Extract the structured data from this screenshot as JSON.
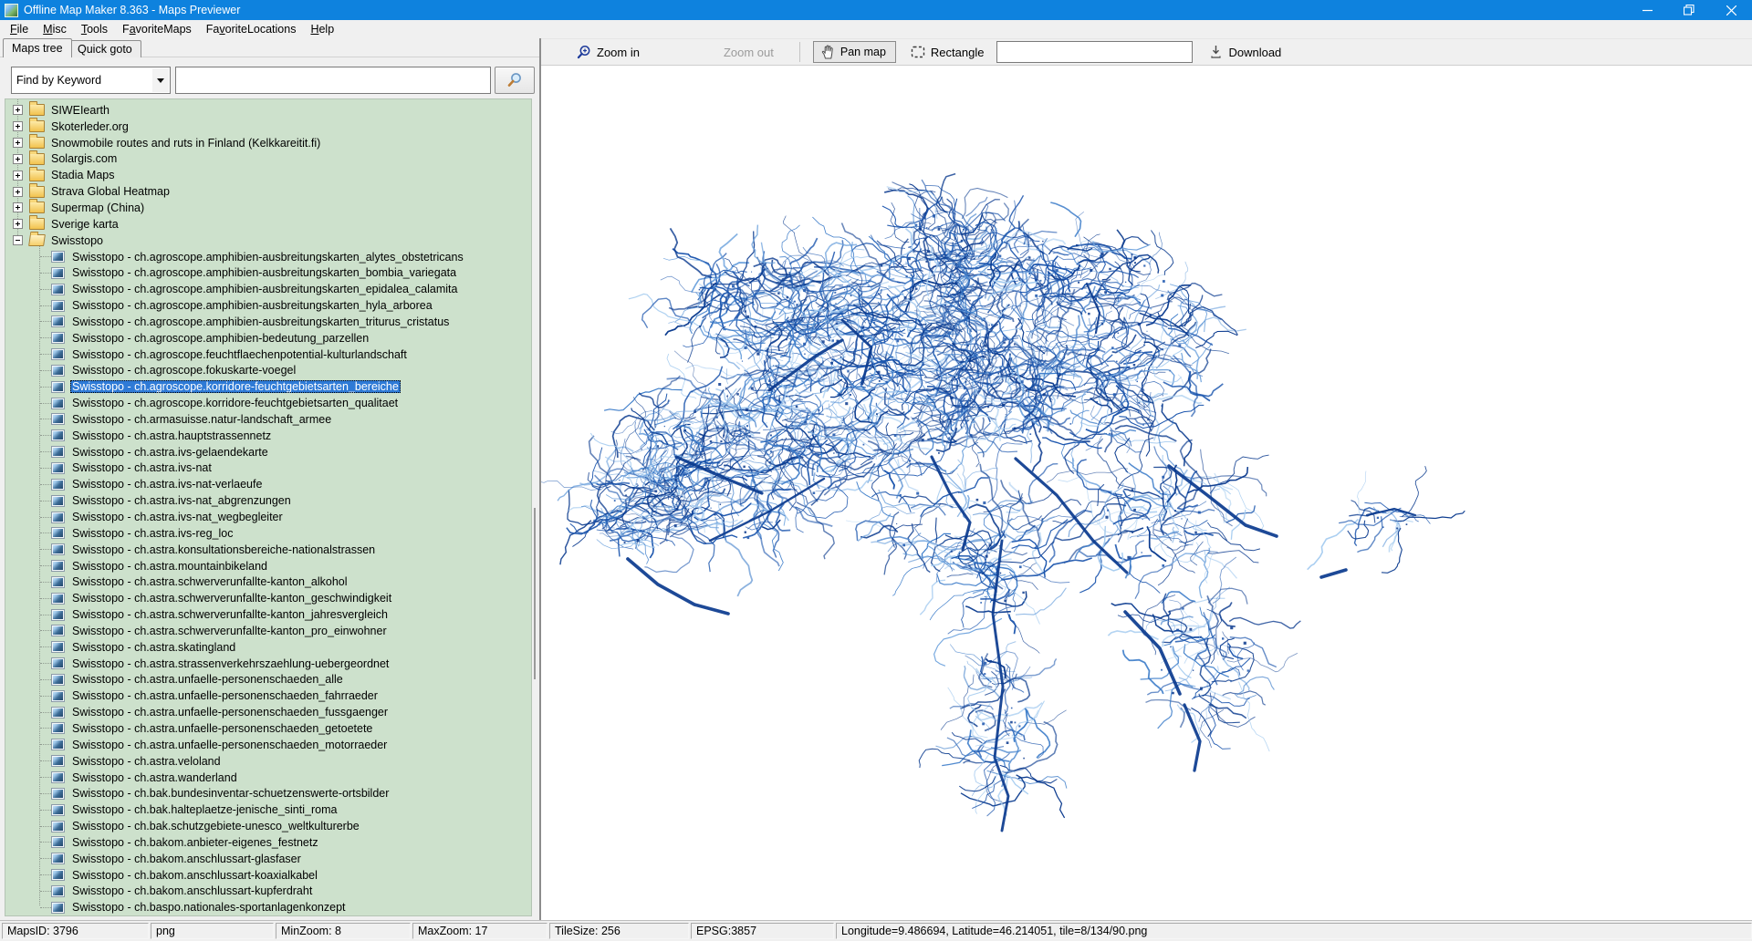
{
  "window": {
    "title": "Offline Map Maker 8.363 - Maps Previewer"
  },
  "titlebar_buttons": {
    "minimize": "minimize",
    "restore": "restore",
    "close": "close"
  },
  "menu": {
    "items": [
      {
        "pre": "",
        "key": "F",
        "post": "ile"
      },
      {
        "pre": "",
        "key": "M",
        "post": "isc"
      },
      {
        "pre": "",
        "key": "T",
        "post": "ools"
      },
      {
        "pre": "F",
        "key": "a",
        "post": "voriteMaps"
      },
      {
        "pre": "Fa",
        "key": "v",
        "post": "oriteLocations"
      },
      {
        "pre": "",
        "key": "H",
        "post": "elp"
      }
    ]
  },
  "left_panel": {
    "tabs": [
      {
        "label": "Maps tree",
        "active": true
      },
      {
        "label": "Quick goto",
        "active": false
      }
    ],
    "search": {
      "mode_value": "Find by Keyword",
      "input_value": "",
      "input_placeholder": ""
    }
  },
  "tree": {
    "rows": [
      {
        "t": "folder",
        "label": "SIWEIearth"
      },
      {
        "t": "folder",
        "label": "Skoterleder.org"
      },
      {
        "t": "folder",
        "label": "Snowmobile routes and ruts in Finland (Kelkkareitit.fi)"
      },
      {
        "t": "folder",
        "label": "Solargis.com"
      },
      {
        "t": "folder",
        "label": "Stadia Maps"
      },
      {
        "t": "folder",
        "label": "Strava Global Heatmap"
      },
      {
        "t": "folder",
        "label": "Supermap (China)"
      },
      {
        "t": "folder",
        "label": "Sverige karta"
      },
      {
        "t": "folder",
        "label": "Swisstopo",
        "expanded": true
      },
      {
        "t": "leaf",
        "label": "Swisstopo - ch.agroscope.amphibien-ausbreitungskarten_alytes_obstetricans"
      },
      {
        "t": "leaf",
        "label": "Swisstopo - ch.agroscope.amphibien-ausbreitungskarten_bombia_variegata"
      },
      {
        "t": "leaf",
        "label": "Swisstopo - ch.agroscope.amphibien-ausbreitungskarten_epidalea_calamita"
      },
      {
        "t": "leaf",
        "label": "Swisstopo - ch.agroscope.amphibien-ausbreitungskarten_hyla_arborea"
      },
      {
        "t": "leaf",
        "label": "Swisstopo - ch.agroscope.amphibien-ausbreitungskarten_triturus_cristatus"
      },
      {
        "t": "leaf",
        "label": "Swisstopo - ch.agroscope.amphibien-bedeutung_parzellen"
      },
      {
        "t": "leaf",
        "label": "Swisstopo - ch.agroscope.feuchtflaechenpotential-kulturlandschaft"
      },
      {
        "t": "leaf",
        "label": "Swisstopo - ch.agroscope.fokuskarte-voegel"
      },
      {
        "t": "leaf",
        "label": "Swisstopo - ch.agroscope.korridore-feuchtgebietsarten_bereiche",
        "selected": true
      },
      {
        "t": "leaf",
        "label": "Swisstopo - ch.agroscope.korridore-feuchtgebietsarten_qualitaet"
      },
      {
        "t": "leaf",
        "label": "Swisstopo - ch.armasuisse.natur-landschaft_armee"
      },
      {
        "t": "leaf",
        "label": "Swisstopo - ch.astra.hauptstrassennetz"
      },
      {
        "t": "leaf",
        "label": "Swisstopo - ch.astra.ivs-gelaendekarte"
      },
      {
        "t": "leaf",
        "label": "Swisstopo - ch.astra.ivs-nat"
      },
      {
        "t": "leaf",
        "label": "Swisstopo - ch.astra.ivs-nat-verlaeufe"
      },
      {
        "t": "leaf",
        "label": "Swisstopo - ch.astra.ivs-nat_abgrenzungen"
      },
      {
        "t": "leaf",
        "label": "Swisstopo - ch.astra.ivs-nat_wegbegleiter"
      },
      {
        "t": "leaf",
        "label": "Swisstopo - ch.astra.ivs-reg_loc"
      },
      {
        "t": "leaf",
        "label": "Swisstopo - ch.astra.konsultationsbereiche-nationalstrassen"
      },
      {
        "t": "leaf",
        "label": "Swisstopo - ch.astra.mountainbikeland"
      },
      {
        "t": "leaf",
        "label": "Swisstopo - ch.astra.schwerverunfallte-kanton_alkohol"
      },
      {
        "t": "leaf",
        "label": "Swisstopo - ch.astra.schwerverunfallte-kanton_geschwindigkeit"
      },
      {
        "t": "leaf",
        "label": "Swisstopo - ch.astra.schwerverunfallte-kanton_jahresvergleich"
      },
      {
        "t": "leaf",
        "label": "Swisstopo - ch.astra.schwerverunfallte-kanton_pro_einwohner"
      },
      {
        "t": "leaf",
        "label": "Swisstopo - ch.astra.skatingland"
      },
      {
        "t": "leaf",
        "label": "Swisstopo - ch.astra.strassenverkehrszaehlung-uebergeordnet"
      },
      {
        "t": "leaf",
        "label": "Swisstopo - ch.astra.unfaelle-personenschaeden_alle"
      },
      {
        "t": "leaf",
        "label": "Swisstopo - ch.astra.unfaelle-personenschaeden_fahrraeder"
      },
      {
        "t": "leaf",
        "label": "Swisstopo - ch.astra.unfaelle-personenschaeden_fussgaenger"
      },
      {
        "t": "leaf",
        "label": "Swisstopo - ch.astra.unfaelle-personenschaeden_getoetete"
      },
      {
        "t": "leaf",
        "label": "Swisstopo - ch.astra.unfaelle-personenschaeden_motorraeder"
      },
      {
        "t": "leaf",
        "label": "Swisstopo - ch.astra.veloland"
      },
      {
        "t": "leaf",
        "label": "Swisstopo - ch.astra.wanderland"
      },
      {
        "t": "leaf",
        "label": "Swisstopo - ch.bak.bundesinventar-schuetzenswerte-ortsbilder"
      },
      {
        "t": "leaf",
        "label": "Swisstopo - ch.bak.halteplaetze-jenische_sinti_roma"
      },
      {
        "t": "leaf",
        "label": "Swisstopo - ch.bak.schutzgebiete-unesco_weltkulturerbe"
      },
      {
        "t": "leaf",
        "label": "Swisstopo - ch.bakom.anbieter-eigenes_festnetz"
      },
      {
        "t": "leaf",
        "label": "Swisstopo - ch.bakom.anschlussart-glasfaser"
      },
      {
        "t": "leaf",
        "label": "Swisstopo - ch.bakom.anschlussart-koaxialkabel"
      },
      {
        "t": "leaf",
        "label": "Swisstopo - ch.bakom.anschlussart-kupferdraht"
      },
      {
        "t": "leaf",
        "label": "Swisstopo - ch.baspo.nationales-sportanlagenkonzept"
      }
    ]
  },
  "toolbar": {
    "zoom_in": "Zoom in",
    "zoom_out": "Zoom out",
    "pan_map": "Pan map",
    "rectangle": "Rectangle",
    "input_value": "",
    "download": "Download"
  },
  "statusbar": {
    "cells": [
      "MapsID: 3796",
      "png",
      "MinZoom: 8",
      "MaxZoom: 17",
      "TileSize: 256",
      "EPSG:3857",
      "Longitude=9.486694, Latitude=46.214051, tile=8/134/90.png"
    ]
  },
  "map": {
    "description": "Swisstopo wetland-corridor layer preview: dense blue vein network in the shape of Switzerland on white",
    "colors": {
      "light": "#a8cdf0",
      "mid": "#3c7cc9",
      "dark": "#0a3a8e",
      "background": "#ffffff"
    }
  },
  "colors": {
    "titlebar": "#0e82de",
    "panel_green": "#cde1cc",
    "selection_blue": "#2e7ad6",
    "chrome_gray": "#f0f0f0"
  }
}
